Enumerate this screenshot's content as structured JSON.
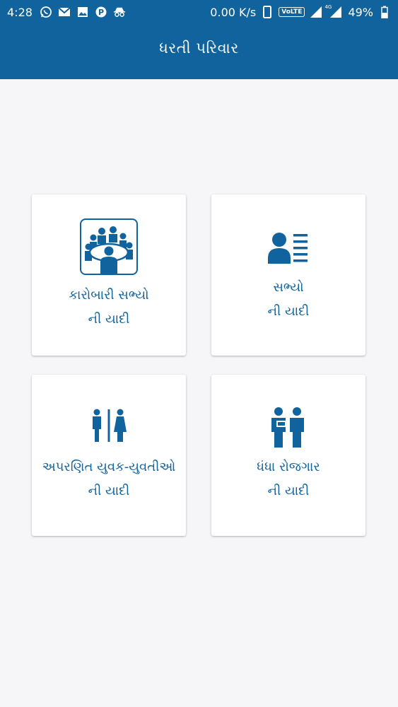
{
  "status_bar": {
    "time": "4:28",
    "network_speed": "0.00 K/s",
    "volte": "VoLTE",
    "signal_tag": "4G",
    "battery": "49%",
    "notification_icons": [
      "whatsapp-icon",
      "gmail-icon",
      "image-icon",
      "paytm-icon",
      "incognito-icon"
    ]
  },
  "app_bar": {
    "title": "ધરતી પરિવાર",
    "background": "#10639c"
  },
  "menu": {
    "accent": "#10639c",
    "cards": [
      {
        "icon": "meeting-group-icon",
        "line1": "કારોબારી સભ્યો",
        "line2": "ની યાદી"
      },
      {
        "icon": "member-list-icon",
        "line1": "સભ્યો",
        "line2": "ની યાદી"
      },
      {
        "icon": "male-female-icon",
        "line1": "અપરણિત યુવક-યુવતીઓ",
        "line2": "ની યાદી"
      },
      {
        "icon": "business-people-icon",
        "line1": "ધંધા રોજગાર",
        "line2": "ની યાદી"
      }
    ]
  }
}
